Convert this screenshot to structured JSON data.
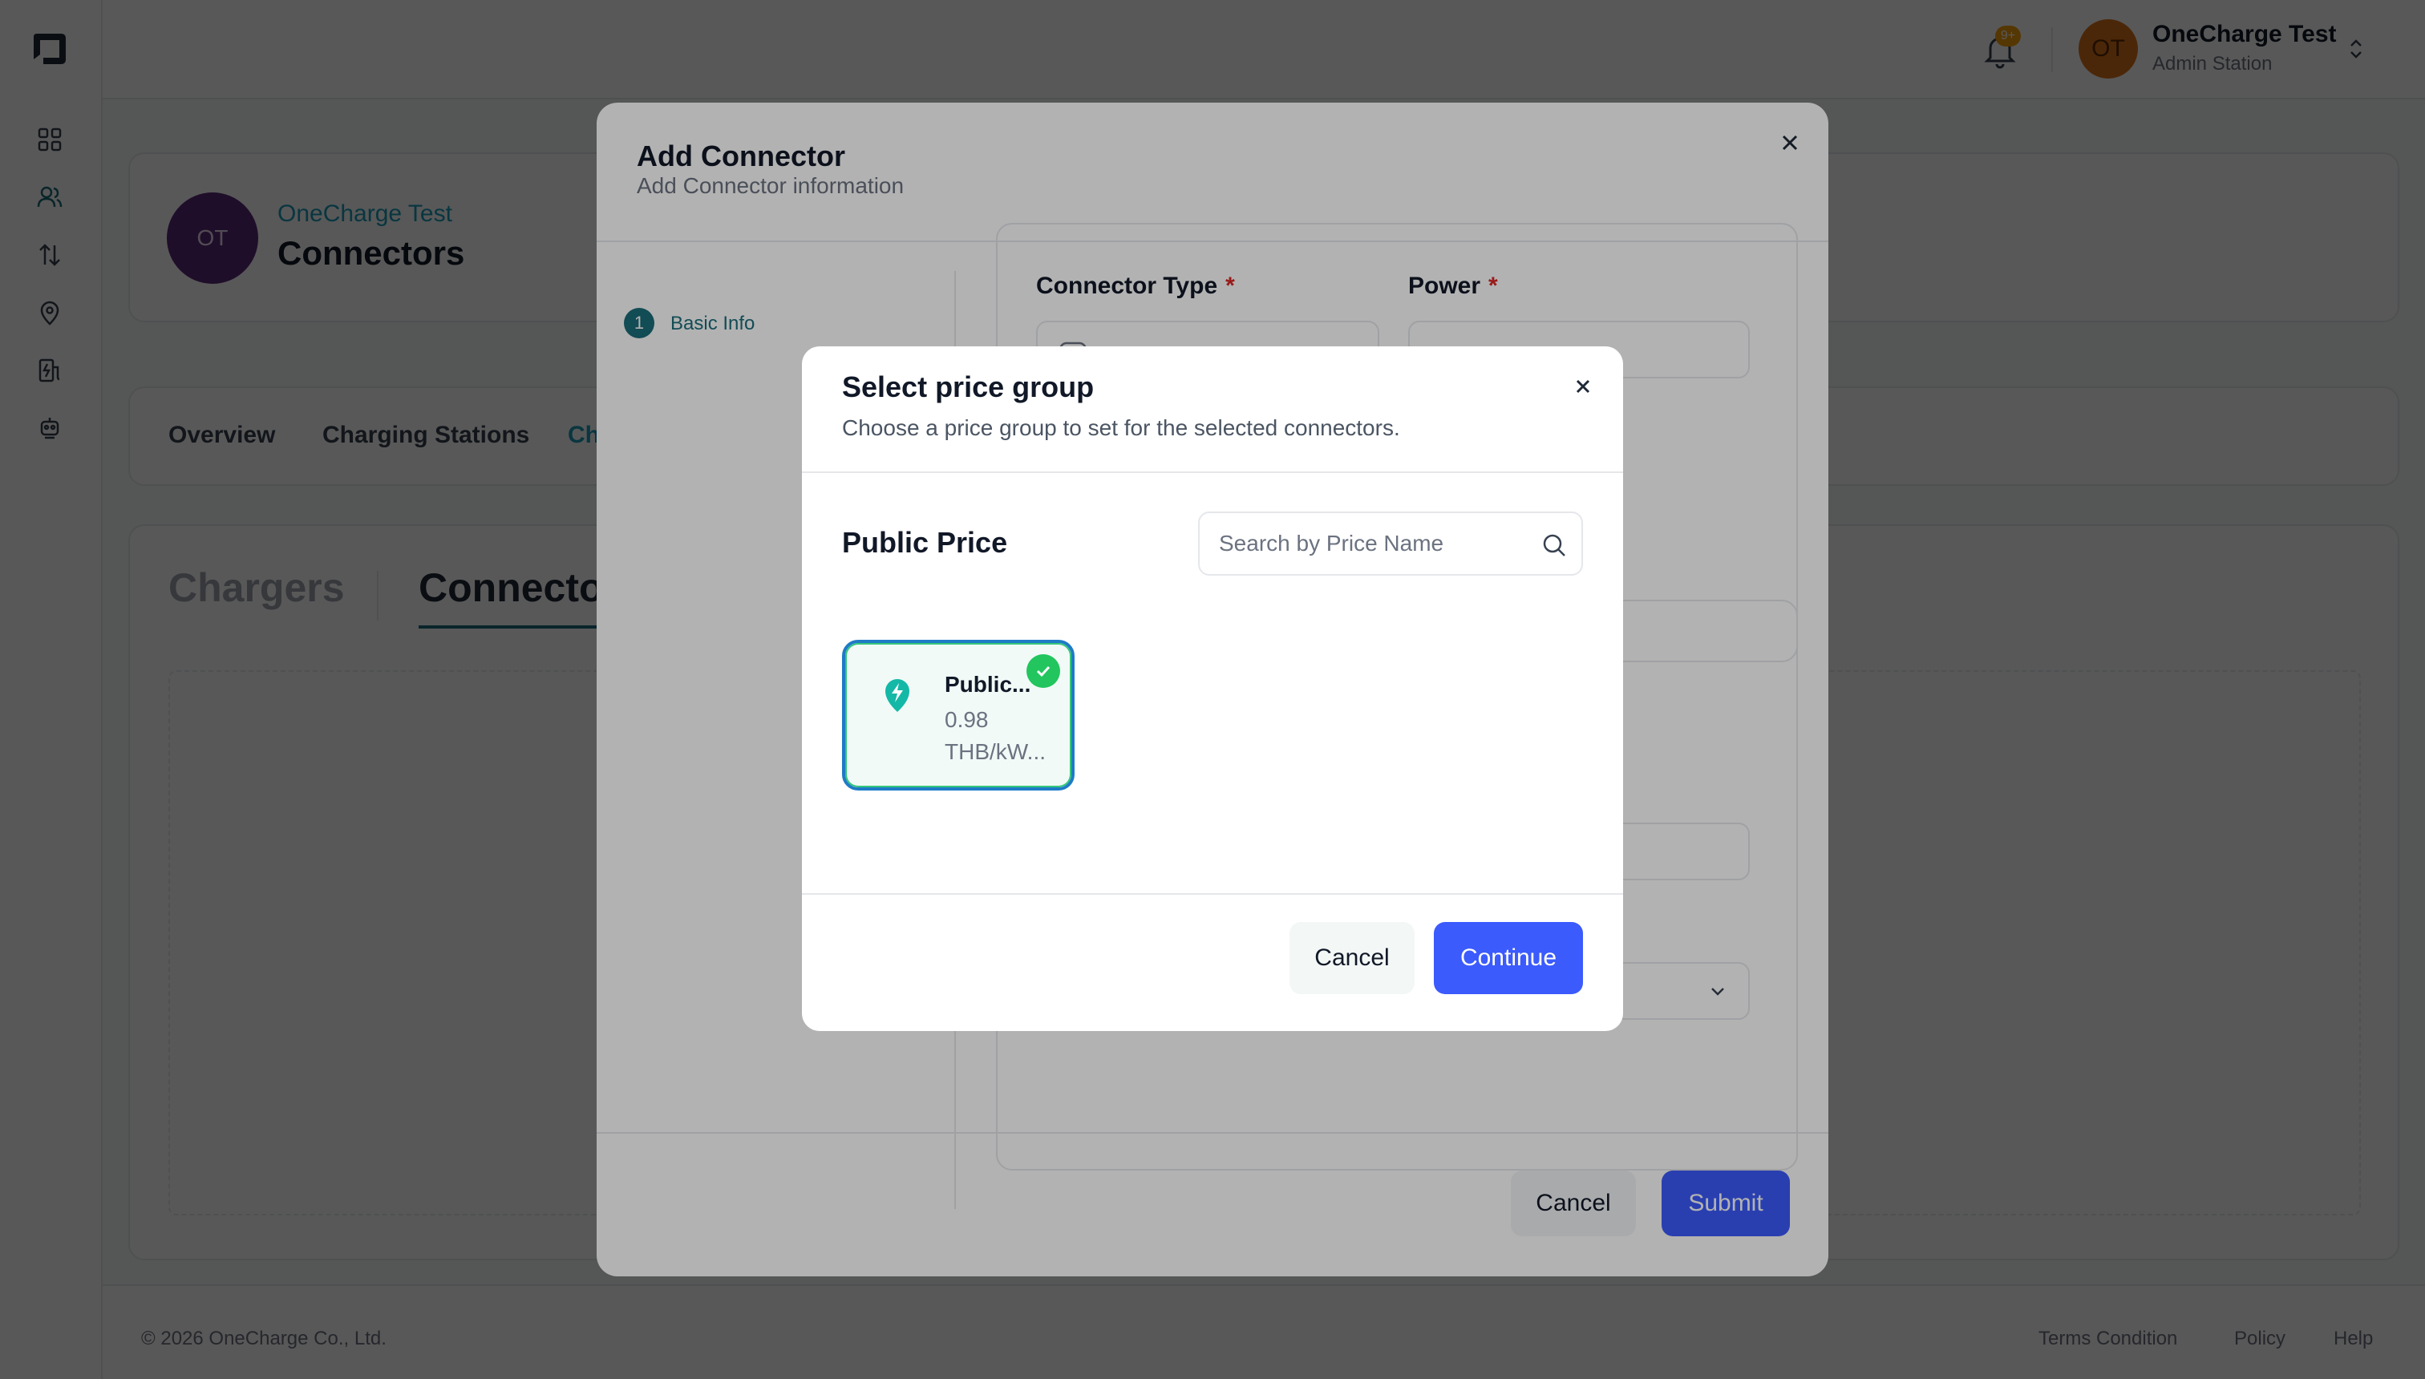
{
  "colors": {
    "primary": "#3b5bfd",
    "teal": "#1b6d7a",
    "brand_link": "#1b9db8",
    "success": "#22c55e",
    "required": "#dc2626",
    "badge": "#f59e0b"
  },
  "sidebar": {
    "logo": "onecharge-logo",
    "items": [
      {
        "icon": "dashboard-grid-icon"
      },
      {
        "icon": "users-icon"
      },
      {
        "icon": "transfer-arrows-icon"
      },
      {
        "icon": "location-pin-icon"
      },
      {
        "icon": "charging-station-icon"
      },
      {
        "icon": "robot-icon"
      }
    ]
  },
  "header": {
    "notification_badge": "9+",
    "user": {
      "initials": "OT",
      "name": "OneCharge Test",
      "role": "Admin Station"
    }
  },
  "organization": {
    "initials": "OT",
    "name": "OneCharge Test",
    "page_title": "Connectors"
  },
  "main_tabs": [
    "Overview",
    "Charging Stations",
    "Ch"
  ],
  "sub_tabs": {
    "chargers": "Chargers",
    "connectors": "Connecto"
  },
  "footer": {
    "copyright": "© 2026 OneCharge Co., Ltd.",
    "links": [
      "Terms Condition",
      "Policy",
      "Help"
    ]
  },
  "add_connector_modal": {
    "title": "Add Connector",
    "subtitle": "Add Connector information",
    "steps": [
      {
        "number": "1",
        "label": "Basic Info"
      }
    ],
    "fields": {
      "connector_type_label": "Connector Type",
      "power_label": "Power",
      "required_mark": "*"
    },
    "cancel_label": "Cancel",
    "submit_label": "Submit"
  },
  "price_group_modal": {
    "title": "Select price group",
    "subtitle": "Choose a price group to set for the selected connectors.",
    "group_title": "Public Price",
    "search_placeholder": "Search by Price Name",
    "cards": [
      {
        "name": "Public...",
        "price": "0.98",
        "unit": "THB/kW...",
        "selected": true
      }
    ],
    "cancel_label": "Cancel",
    "continue_label": "Continue"
  }
}
